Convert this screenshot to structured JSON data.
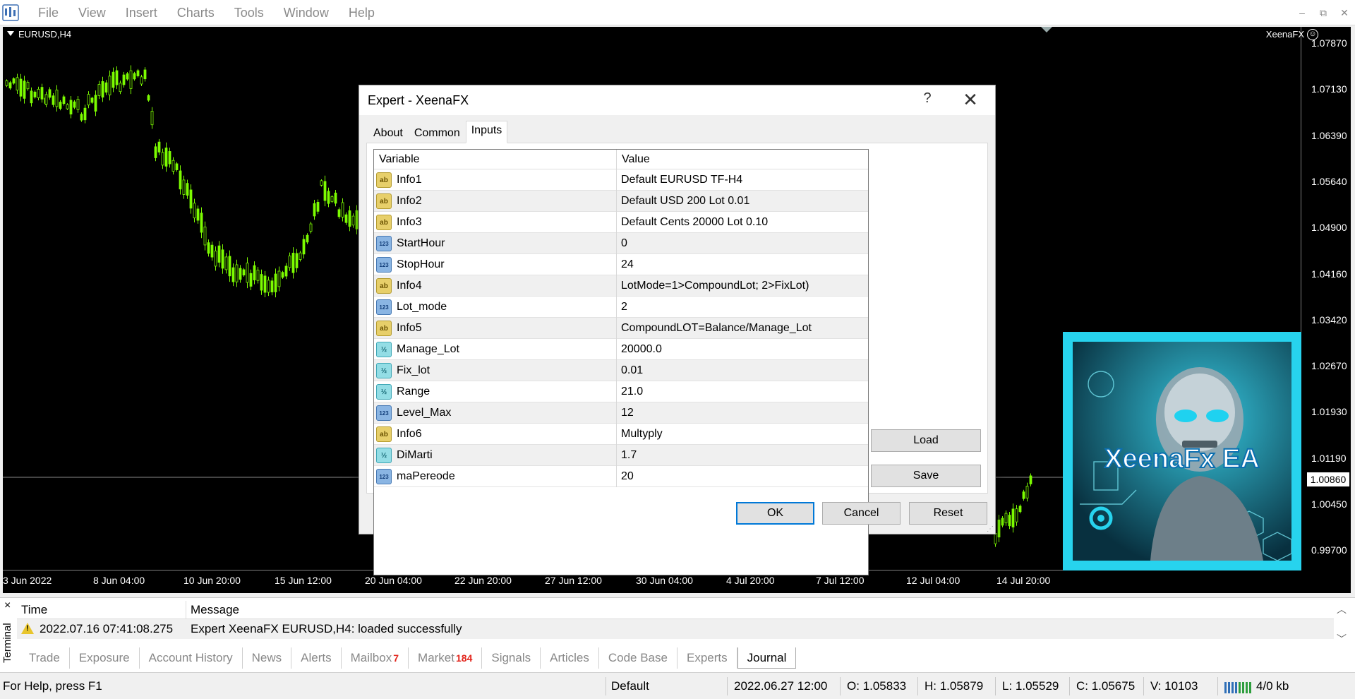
{
  "menubar": {
    "items": [
      "File",
      "View",
      "Insert",
      "Charts",
      "Tools",
      "Window",
      "Help"
    ],
    "window_controls": [
      "–",
      "⧉",
      "✕"
    ]
  },
  "chart": {
    "symbol": "EURUSD,H4",
    "ea_name": "XeenaFX",
    "price_ticks": [
      "1.07870",
      "1.07130",
      "1.06390",
      "1.05640",
      "1.04900",
      "1.04160",
      "1.03420",
      "1.02670",
      "1.01930",
      "1.01190",
      "1.00450",
      "0.99700"
    ],
    "current_price": "1.00860",
    "time_ticks": [
      "3 Jun 2022",
      "8 Jun 04:00",
      "10 Jun 20:00",
      "15 Jun 12:00",
      "20 Jun 04:00",
      "22 Jun 20:00",
      "27 Jun 12:00",
      "30 Jun 04:00",
      "4 Jul 20:00",
      "7 Jul 12:00",
      "12 Jul 04:00",
      "14 Jul 20:00"
    ],
    "colors": {
      "background": "#000000",
      "candle": "#7cfc00",
      "text": "#ffffff"
    }
  },
  "logo": {
    "text": "XeenaFx EA",
    "frame_color": "#27d3ee"
  },
  "dialog": {
    "title": "Expert - XeenaFX",
    "help": "?",
    "close": "✕",
    "tabs": [
      "About",
      "Common",
      "Inputs"
    ],
    "active_tab": "Inputs",
    "columns": {
      "variable": "Variable",
      "value": "Value"
    },
    "inputs": [
      {
        "type": "str",
        "icon": "ab",
        "name": "Info1",
        "value": "Default EURUSD TF-H4"
      },
      {
        "type": "str",
        "icon": "ab",
        "name": "Info2",
        "value": "Default USD 200 Lot 0.01"
      },
      {
        "type": "str",
        "icon": "ab",
        "name": "Info3",
        "value": "Default Cents 20000 Lot 0.10"
      },
      {
        "type": "int",
        "icon": "123",
        "name": "StartHour",
        "value": "0"
      },
      {
        "type": "int",
        "icon": "123",
        "name": "StopHour",
        "value": "24"
      },
      {
        "type": "str",
        "icon": "ab",
        "name": "Info4",
        "value": "LotMode=1>CompoundLot; 2>FixLot)"
      },
      {
        "type": "int",
        "icon": "123",
        "name": "Lot_mode",
        "value": "2"
      },
      {
        "type": "str",
        "icon": "ab",
        "name": "Info5",
        "value": "CompoundLOT=Balance/Manage_Lot"
      },
      {
        "type": "dbl",
        "icon": "½",
        "name": "Manage_Lot",
        "value": "20000.0"
      },
      {
        "type": "dbl",
        "icon": "½",
        "name": "Fix_lot",
        "value": "0.01"
      },
      {
        "type": "dbl",
        "icon": "½",
        "name": "Range",
        "value": "21.0"
      },
      {
        "type": "int",
        "icon": "123",
        "name": "Level_Max",
        "value": "12"
      },
      {
        "type": "str",
        "icon": "ab",
        "name": "Info6",
        "value": "Multyply"
      },
      {
        "type": "dbl",
        "icon": "½",
        "name": "DiMarti",
        "value": "1.7"
      },
      {
        "type": "int",
        "icon": "123",
        "name": "maPereode",
        "value": "20"
      }
    ],
    "buttons": {
      "load": "Load",
      "save": "Save",
      "ok": "OK",
      "cancel": "Cancel",
      "reset": "Reset"
    }
  },
  "terminal": {
    "label": "Terminal",
    "close": "×",
    "columns": {
      "time": "Time",
      "message": "Message"
    },
    "rows": [
      {
        "time": "2022.07.16 07:41:08.275",
        "message": "Expert XeenaFX EURUSD,H4: loaded successfully"
      }
    ],
    "tabs": [
      {
        "label": "Trade"
      },
      {
        "label": "Exposure"
      },
      {
        "label": "Account History"
      },
      {
        "label": "News"
      },
      {
        "label": "Alerts"
      },
      {
        "label": "Mailbox",
        "badge": "7"
      },
      {
        "label": "Market",
        "badge": "184"
      },
      {
        "label": "Signals"
      },
      {
        "label": "Articles"
      },
      {
        "label": "Code Base"
      },
      {
        "label": "Experts"
      },
      {
        "label": "Journal"
      }
    ],
    "active_tab": "Journal"
  },
  "statusbar": {
    "help": "For Help, press F1",
    "profile": "Default",
    "datetime": "2022.06.27 12:00",
    "open": "O: 1.05833",
    "high": "H: 1.05879",
    "low": "L: 1.05529",
    "close": "C: 1.05675",
    "volume": "V: 10103",
    "traffic": "4/0 kb"
  }
}
